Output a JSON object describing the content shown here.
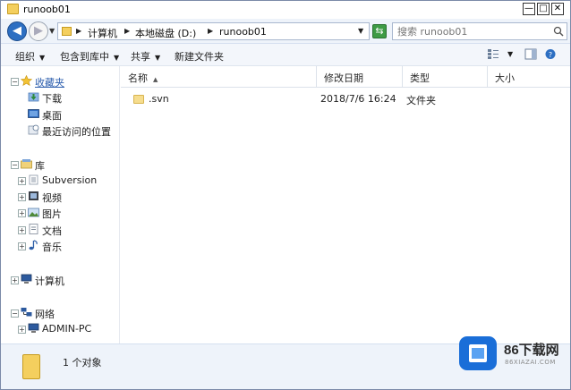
{
  "window": {
    "title": "runoob01",
    "minimize_label": "—",
    "maximize_label": "□",
    "close_label": "✕"
  },
  "address": {
    "recent_arrow": "▼",
    "breadcrumbs": [
      "计算机",
      "本地磁盘 (D:)",
      "runoob01"
    ],
    "separator": "▶",
    "dropdown": "▼",
    "refresh_icon": "⇆",
    "search_placeholder": "搜索 runoob01"
  },
  "commands": {
    "organize": "组织",
    "include_in_library": "包含到库中",
    "share": "共享",
    "new_folder": "新建文件夹",
    "dropdown_arrow": "▼"
  },
  "navigation": {
    "favorites": {
      "label": "收藏夹",
      "items": [
        "下载",
        "桌面",
        "最近访问的位置"
      ]
    },
    "libraries": {
      "label": "库",
      "items": [
        "Subversion",
        "视频",
        "图片",
        "文档",
        "音乐"
      ]
    },
    "computer": {
      "label": "计算机"
    },
    "network": {
      "label": "网络",
      "items": [
        "ADMIN-PC"
      ]
    },
    "expander_collapsed": "+",
    "expander_expanded": "−"
  },
  "columns": {
    "name": "名称",
    "modified": "修改日期",
    "type": "类型",
    "size": "大小",
    "sort_indicator": "▲"
  },
  "files": [
    {
      "name": ".svn",
      "modified": "2018/7/6 16:24",
      "type": "文件夹",
      "size": ""
    }
  ],
  "details": {
    "count_text": "1 个对象"
  },
  "watermark": {
    "brand": "86下载网",
    "url": "86XIAZAI.COM"
  },
  "colors": {
    "accent": "#2d6fc2",
    "folder": "#f4cf5e",
    "watermark": "#1a6ed8"
  }
}
